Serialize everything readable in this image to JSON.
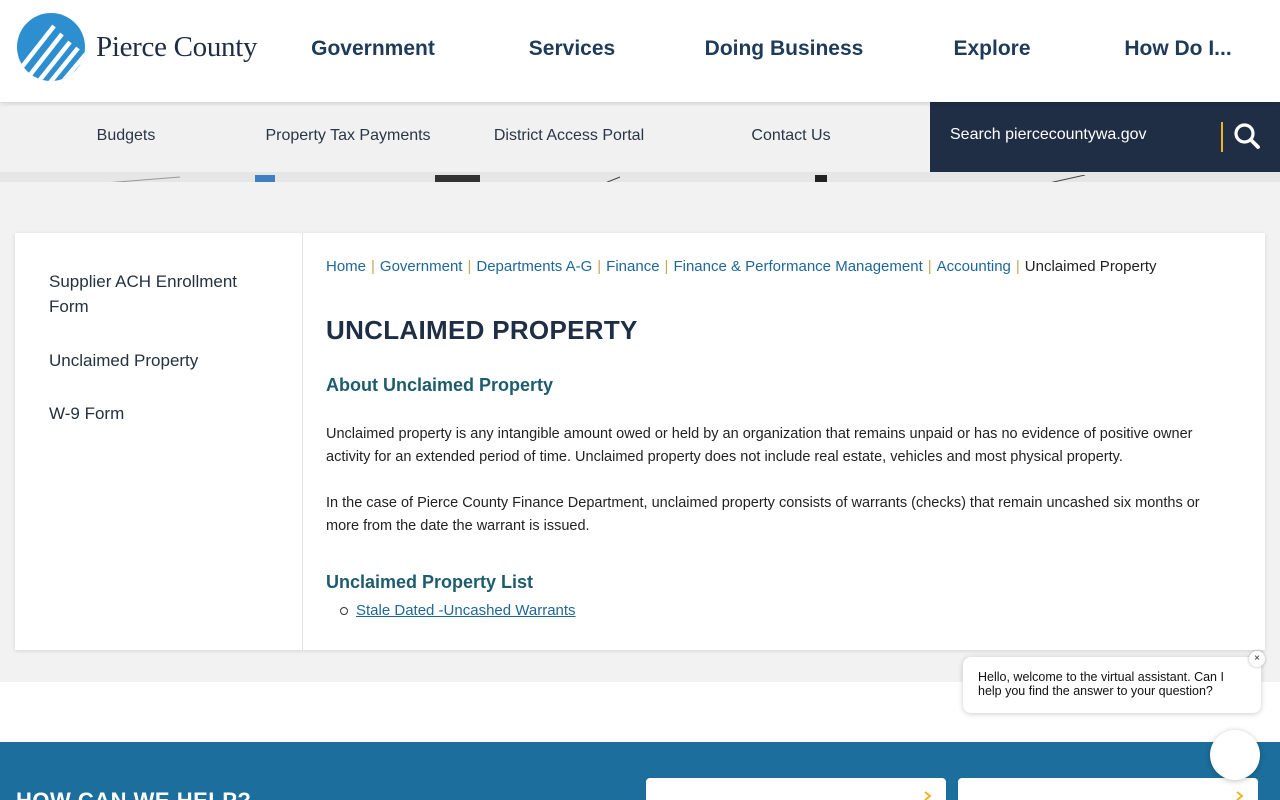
{
  "header": {
    "logo_text": "Pierce County",
    "nav": [
      "Government",
      "Services",
      "Doing Business",
      "Explore",
      "How Do I..."
    ]
  },
  "subnav": {
    "links": [
      "Budgets",
      "Property Tax Payments",
      "District Access Portal",
      "Contact Us"
    ]
  },
  "search": {
    "placeholder": "Search piercecountywa.gov",
    "icon": "search-icon"
  },
  "sidebar": {
    "items": [
      "Supplier ACH Enrollment Form",
      "Unclaimed Property",
      "W-9 Form"
    ]
  },
  "breadcrumb": {
    "links": [
      "Home",
      "Government",
      "Departments A-G",
      "Finance",
      "Finance & Performance Management",
      "Accounting"
    ],
    "current": "Unclaimed Property"
  },
  "content": {
    "title": "UNCLAIMED PROPERTY",
    "about_heading": "About Unclaimed Property",
    "para1": "Unclaimed property is any intangible amount owed or held by an organization that remains unpaid or has no evidence of positive owner activity for an extended period of time. Unclaimed property does not include real estate, vehicles and most physical property.",
    "para2": "In the case of Pierce County Finance Department, unclaimed property consists of warrants (checks) that remain uncashed six months or more from the date the warrant is issued.",
    "list_heading": "Unclaimed Property List",
    "list_items": [
      "Stale Dated -Uncashed Warrants"
    ]
  },
  "footer": {
    "heading": "HOW CAN WE HELP?"
  },
  "chat": {
    "message": "Hello, welcome to the virtual assistant. Can I help you find the answer to your question?",
    "close": "×"
  },
  "colors": {
    "navy": "#1f2d45",
    "link": "#1f6799",
    "accent": "#f0b323",
    "footer": "#1c6e9c"
  }
}
